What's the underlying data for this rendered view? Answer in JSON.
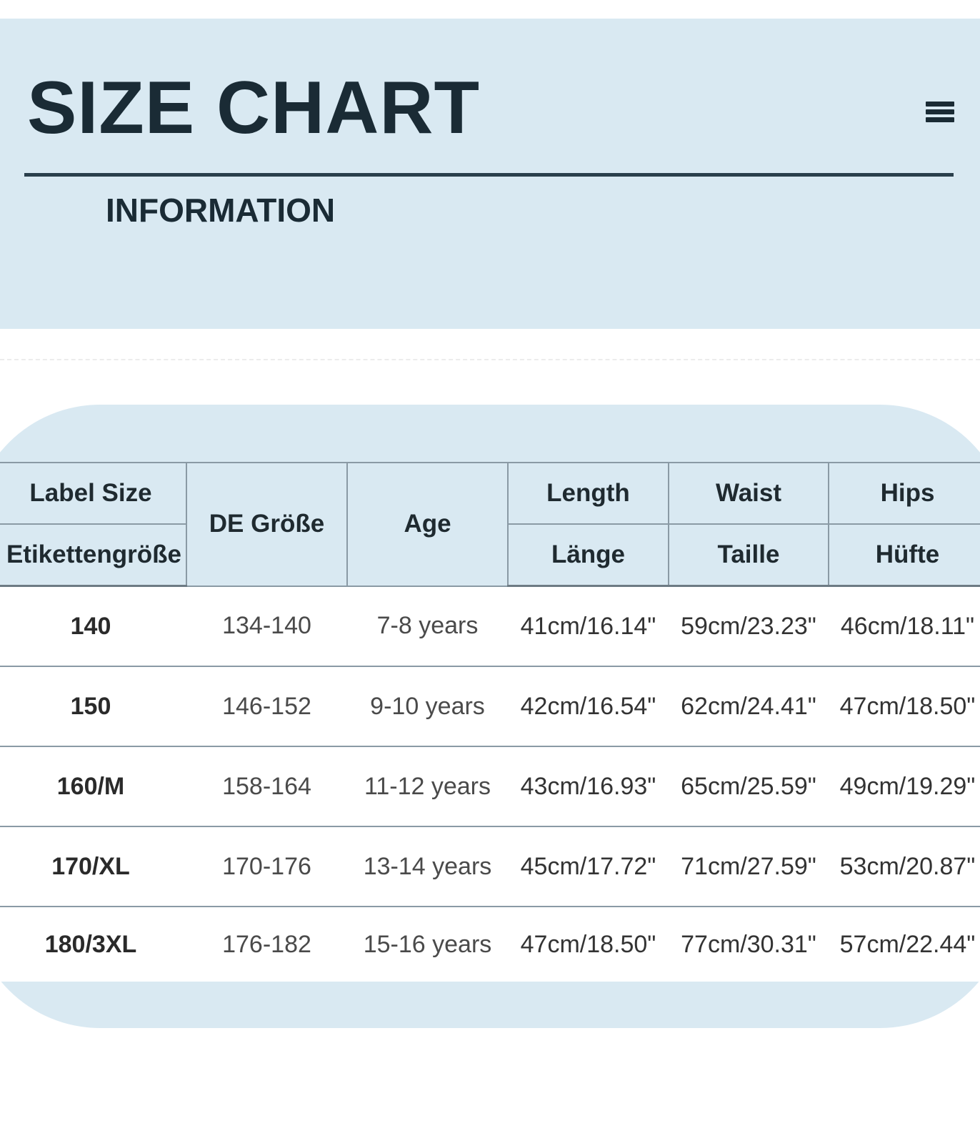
{
  "header": {
    "title": "SIZE CHART",
    "subtitle": "INFORMATION",
    "menu_icon": "hamburger-menu-icon"
  },
  "colors": {
    "band": "#d9e9f2",
    "title": "#1a2b35",
    "rule": "#2a3f4c",
    "grid": "#8a9aa5"
  },
  "table": {
    "headers": {
      "label_size": "Label Size",
      "label_size_de": "Etikettengröße",
      "de_size": "DE Größe",
      "age": "Age",
      "length": "Length",
      "length_de": "Länge",
      "waist": "Waist",
      "waist_de": "Taille",
      "hips": "Hips",
      "hips_de": "Hüfte"
    },
    "rows": [
      {
        "label": "140",
        "de": "134-140",
        "age": "7-8 years",
        "length": "41cm/16.14\"",
        "waist": "59cm/23.23\"",
        "hips": "46cm/18.11\""
      },
      {
        "label": "150",
        "de": "146-152",
        "age": "9-10 years",
        "length": "42cm/16.54\"",
        "waist": "62cm/24.41\"",
        "hips": "47cm/18.50\""
      },
      {
        "label": "160/M",
        "de": "158-164",
        "age": "11-12 years",
        "length": "43cm/16.93\"",
        "waist": "65cm/25.59\"",
        "hips": "49cm/19.29\""
      },
      {
        "label": "170/XL",
        "de": "170-176",
        "age": "13-14 years",
        "length": "45cm/17.72\"",
        "waist": "71cm/27.59\"",
        "hips": "53cm/20.87\""
      },
      {
        "label": "180/3XL",
        "de": "176-182",
        "age": "15-16 years",
        "length": "47cm/18.50\"",
        "waist": "77cm/30.31\"",
        "hips": "57cm/22.44\""
      }
    ]
  }
}
